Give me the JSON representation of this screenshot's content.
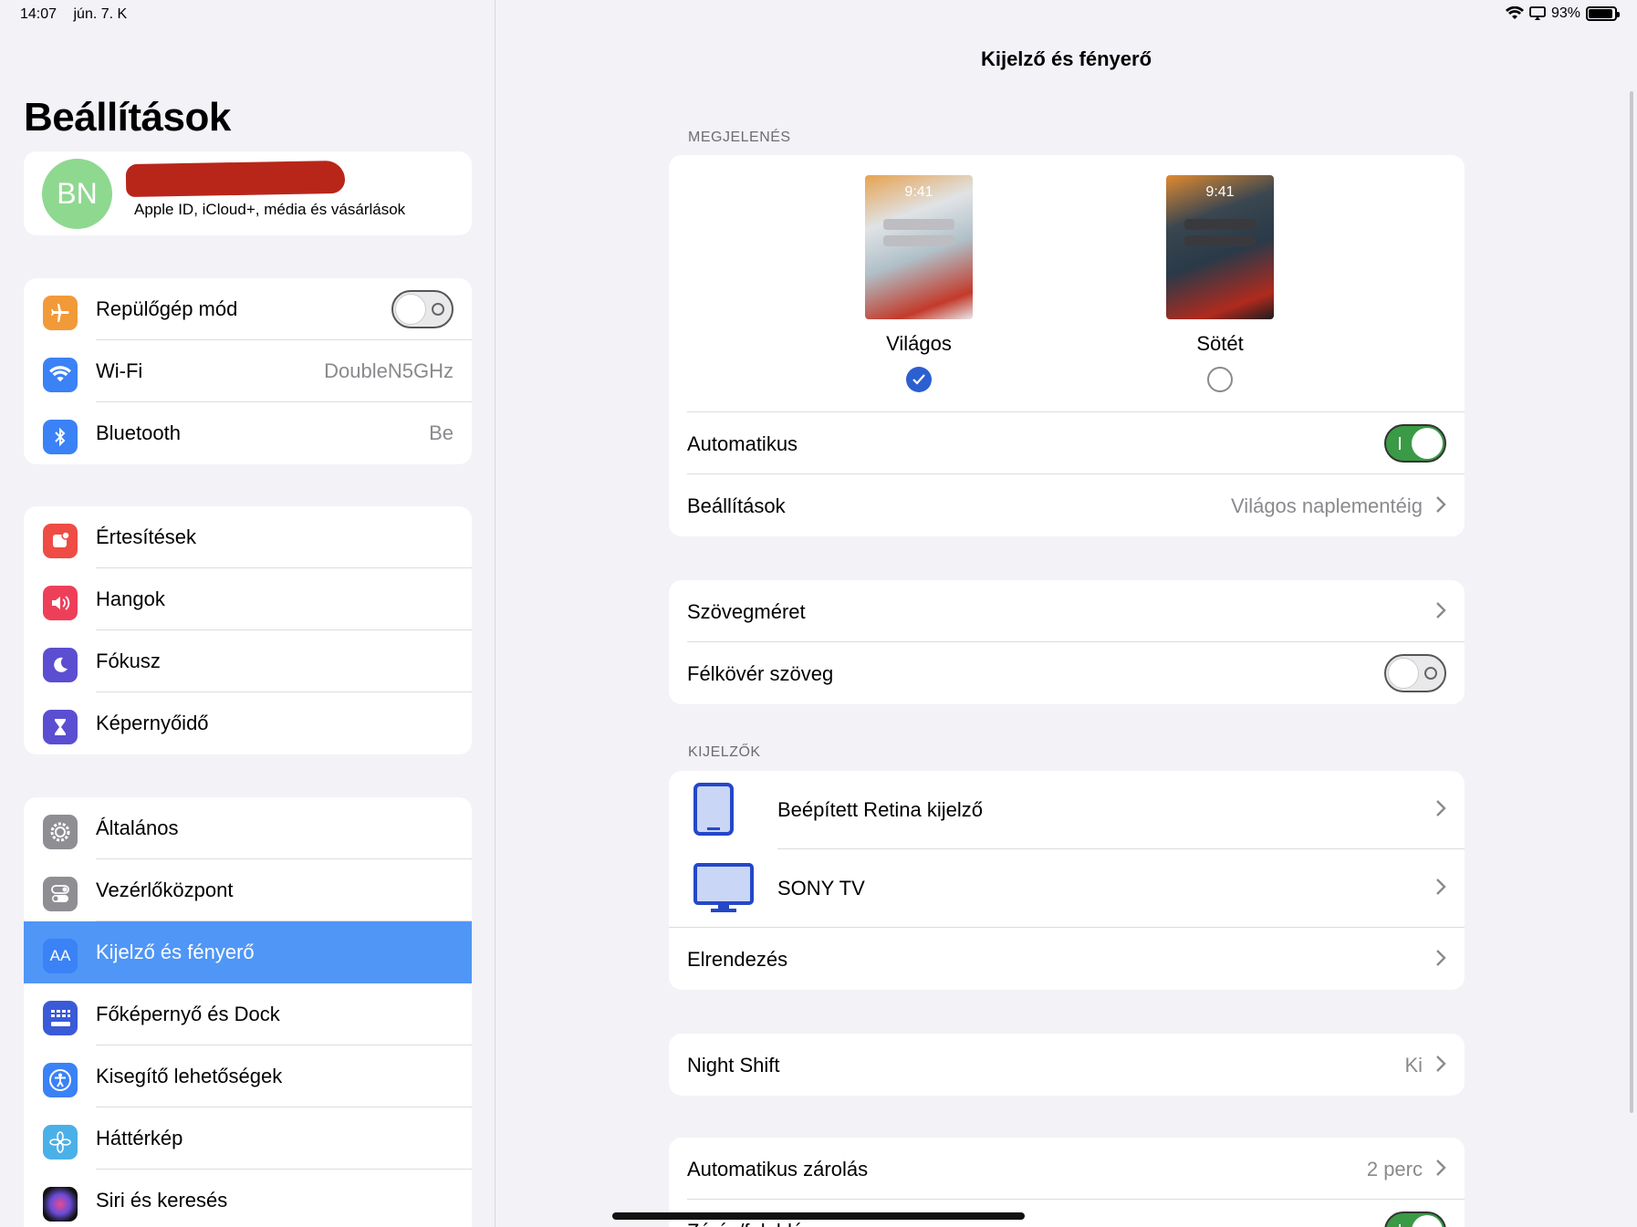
{
  "status_bar": {
    "time": "14:07",
    "date": "jún. 7. K",
    "battery": "93%",
    "battery_level": 0.93
  },
  "sidebar": {
    "title": "Beállítások",
    "profile": {
      "initials": "BN",
      "subtitle": "Apple ID, iCloud+, média és vásárlások"
    },
    "group1": [
      {
        "label": "Repülőgép mód",
        "icon": "airplane-icon",
        "color": "#f29a38",
        "toggle": false
      },
      {
        "label": "Wi-Fi",
        "icon": "wifi-icon",
        "color": "#3a82f6",
        "value": "DoubleN5GHz"
      },
      {
        "label": "Bluetooth",
        "icon": "bluetooth-icon",
        "color": "#3a82f6",
        "value": "Be"
      }
    ],
    "group2": [
      {
        "label": "Értesítések",
        "icon": "bell-icon",
        "color": "#ee4c45"
      },
      {
        "label": "Hangok",
        "icon": "speaker-icon",
        "color": "#ee3f59"
      },
      {
        "label": "Fókusz",
        "icon": "moon-icon",
        "color": "#5b4ed1"
      },
      {
        "label": "Képernyőidő",
        "icon": "hourglass-icon",
        "color": "#5b4ed1"
      }
    ],
    "group3": [
      {
        "label": "Általános",
        "icon": "gear-icon",
        "color": "#8e8e93"
      },
      {
        "label": "Vezérlőközpont",
        "icon": "switches-icon",
        "color": "#8e8e93"
      },
      {
        "label": "Kijelző és fényerő",
        "icon": "aa-icon",
        "color": "#3a82f6",
        "selected": true,
        "icon_text": "AA"
      },
      {
        "label": "Főképernyő és Dock",
        "icon": "grid-icon",
        "color": "#3a5ad8"
      },
      {
        "label": "Kisegítő lehetőségek",
        "icon": "accessibility-icon",
        "color": "#3a82f6"
      },
      {
        "label": "Háttérkép",
        "icon": "flower-icon",
        "color": "#4ab0e8"
      },
      {
        "label": "Siri és keresés",
        "icon": "siri-icon",
        "color": "#222222"
      }
    ]
  },
  "main": {
    "title": "Kijelző és fényerő",
    "appearance_header": "MEGJELENÉS",
    "themes": [
      {
        "label": "Világos",
        "time": "9:41",
        "selected": true
      },
      {
        "label": "Sötét",
        "time": "9:41",
        "selected": false
      }
    ],
    "automatic": {
      "label": "Automatikus",
      "toggle": true
    },
    "options": {
      "label": "Beállítások",
      "value": "Világos naplementéig"
    },
    "text_size": {
      "label": "Szövegméret"
    },
    "bold_text": {
      "label": "Félkövér szöveg",
      "toggle": false
    },
    "displays_header": "KIJELZŐK",
    "displays": [
      {
        "label": "Beépített Retina kijelző",
        "icon": "ipad-icon"
      },
      {
        "label": "SONY TV",
        "icon": "monitor-icon"
      }
    ],
    "arrangement": {
      "label": "Elrendezés"
    },
    "night_shift": {
      "label": "Night Shift",
      "value": "Ki"
    },
    "auto_lock": {
      "label": "Automatikus zárolás",
      "value": "2 perc"
    },
    "lock_unlock": {
      "label": "Zárás/feloldás",
      "toggle": true
    }
  }
}
